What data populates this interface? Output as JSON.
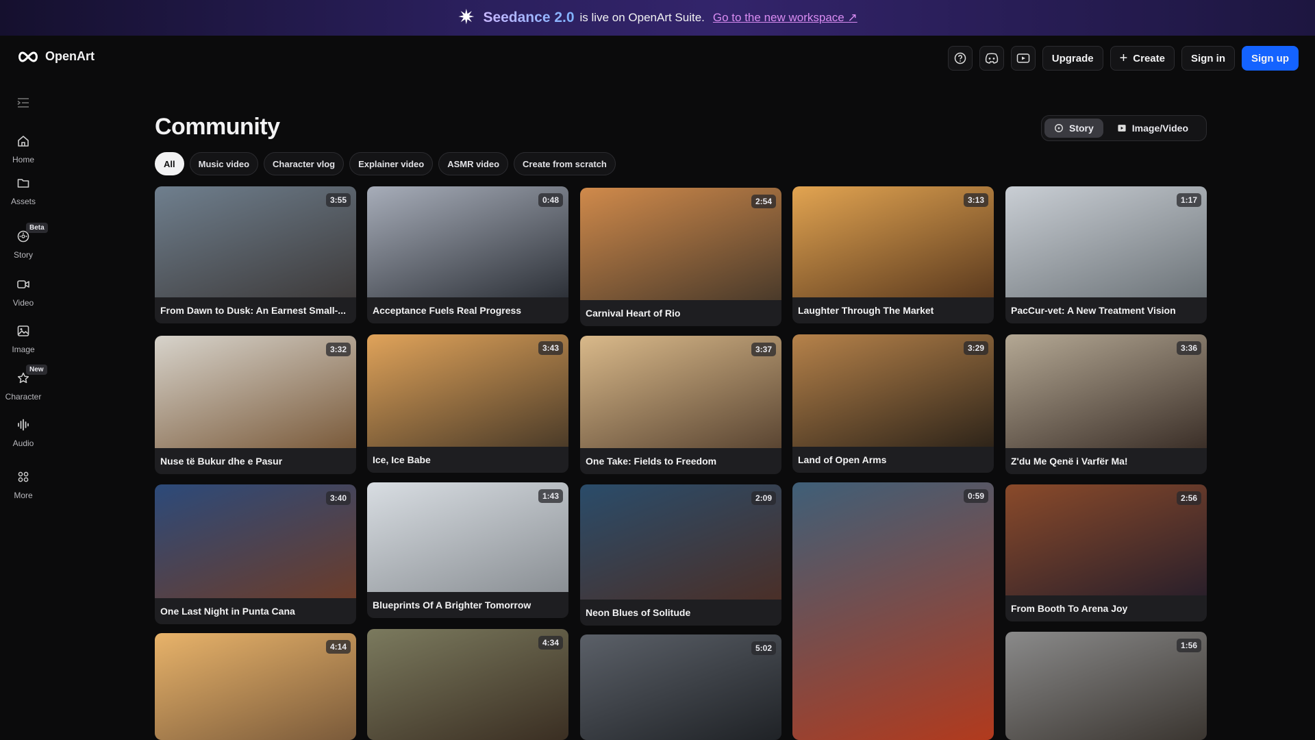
{
  "banner": {
    "brand": "Seedance 2.0",
    "text": "is live on OpenArt Suite.",
    "link": "Go to the new workspace ↗"
  },
  "header": {
    "logo": "OpenArt",
    "upgrade": "Upgrade",
    "create": "Create",
    "sign_in": "Sign in",
    "sign_up": "Sign up"
  },
  "sidebar": {
    "items": [
      {
        "label": "Home",
        "icon": "home-icon"
      },
      {
        "label": "Assets",
        "icon": "folder-icon"
      },
      {
        "label": "Story",
        "icon": "story-icon",
        "badge": "Beta"
      },
      {
        "label": "Video",
        "icon": "video-icon"
      },
      {
        "label": "Image",
        "icon": "image-icon"
      },
      {
        "label": "Character",
        "icon": "character-icon",
        "badge": "New"
      },
      {
        "label": "Audio",
        "icon": "audio-icon"
      },
      {
        "label": "More",
        "icon": "more-icon"
      }
    ]
  },
  "main": {
    "title": "Community",
    "toggle": {
      "story": "Story",
      "image_video": "Image/Video"
    },
    "chips": [
      "All",
      "Music video",
      "Character vlog",
      "Explainer video",
      "ASMR video",
      "Create from scratch"
    ],
    "cards": [
      {
        "title": "From Dawn to Dusk: An Earnest Small-...",
        "duration": "3:55",
        "colors": [
          "#6f7f8e",
          "#3d3a3a"
        ]
      },
      {
        "title": "Acceptance Fuels Real Progress",
        "duration": "0:48",
        "colors": [
          "#a7adb9",
          "#2d3138"
        ]
      },
      {
        "title": "Carnival Heart of Rio",
        "duration": "2:54",
        "colors": [
          "#d08a4b",
          "#4a3a2a"
        ]
      },
      {
        "title": "Laughter Through The Market",
        "duration": "3:13",
        "colors": [
          "#e2a451",
          "#5b3a1e"
        ]
      },
      {
        "title": "PacCur-vet: A New Treatment Vision",
        "duration": "1:17",
        "colors": [
          "#c9ced4",
          "#6d7479"
        ]
      },
      {
        "title": "Nuse të Bukur dhe e Pasur",
        "duration": "3:32",
        "colors": [
          "#d7d3cb",
          "#7a5a3a"
        ]
      },
      {
        "title": "Ice, Ice Babe",
        "duration": "3:43",
        "colors": [
          "#e0a35a",
          "#4b3b28"
        ]
      },
      {
        "title": "One Take: Fields to Freedom",
        "duration": "3:37",
        "colors": [
          "#d9b98a",
          "#5a4532"
        ]
      },
      {
        "title": "Land of Open Arms",
        "duration": "3:29",
        "colors": [
          "#b6824a",
          "#2e2419"
        ]
      },
      {
        "title": "Z'du Me Qenë i Varfër Ma!",
        "duration": "3:36",
        "colors": [
          "#b4a894",
          "#3b2f28"
        ]
      },
      {
        "title": "One Last Night in Punta Cana",
        "duration": "3:40",
        "colors": [
          "#2c4a7a",
          "#6b3c2a"
        ]
      },
      {
        "title": "Blueprints Of A Brighter Tomorrow",
        "duration": "1:43",
        "colors": [
          "#d8dde2",
          "#8a8f94"
        ]
      },
      {
        "title": "Neon Blues of Solitude",
        "duration": "2:09",
        "colors": [
          "#2a4c6a",
          "#4a2f28"
        ]
      },
      {
        "title": "",
        "duration": "0:59",
        "colors": [
          "#3f5f78",
          "#b23a1d"
        ]
      },
      {
        "title": "From Booth To Arena Joy",
        "duration": "2:56",
        "colors": [
          "#8a4a2a",
          "#2a1f2a"
        ]
      },
      {
        "title": "",
        "duration": "4:14",
        "colors": [
          "#e8b36a",
          "#7a5a3a"
        ]
      },
      {
        "title": "",
        "duration": "4:34",
        "colors": [
          "#7b7a5e",
          "#3a2e22"
        ]
      },
      {
        "title": "",
        "duration": "5:02",
        "colors": [
          "#5b6068",
          "#1f2226"
        ]
      },
      {
        "title": "",
        "duration": "1:56",
        "colors": [
          "#8a8a8a",
          "#3a3530"
        ]
      }
    ]
  }
}
